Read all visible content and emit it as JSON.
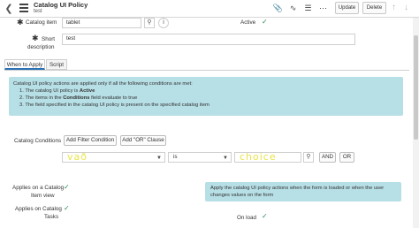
{
  "header": {
    "title": "Catalog UI Policy",
    "subtitle": "test",
    "update_label": "Update",
    "delete_label": "Delete",
    "icons": [
      "attachment-icon",
      "activity-icon",
      "settings-sliders-icon",
      "more-icon",
      "arrow-up-icon",
      "arrow-down-icon"
    ]
  },
  "form": {
    "catalog_item_label": "Catalog item",
    "catalog_item_value": "tablet",
    "active_label": "Active",
    "short_description_label_1": "Short",
    "short_description_label_2": "description",
    "short_description_value": "test"
  },
  "tabs": [
    {
      "label": "When to Apply",
      "active": true
    },
    {
      "label": "Script",
      "active": false
    }
  ],
  "info": {
    "line1": "Catalog UI policy actions are applied only if all the following conditions are met:",
    "item1_prefix": "1. The catalog UI policy is ",
    "item1_bold": "Active",
    "item2_prefix": "2. The items in the ",
    "item2_bold": "Conditions",
    "item2_suffix": " field evaluate to true",
    "item3": "3. The field specified in the catalog UI policy is present on the specified catalog item"
  },
  "conditions": {
    "label": "Catalog Conditions",
    "add_filter_label": "Add Filter Condition",
    "add_or_label": "Add \"OR\" Clause",
    "field_value": "vað",
    "operator_value": "is",
    "value_value": "choice",
    "and_label": "AND",
    "or_label": "OR"
  },
  "apply": {
    "view_label_1": "Applies on a Catalog",
    "view_label_2": "Item view",
    "tasks_label_1": "Applies on Catalog",
    "tasks_label_2": "Tasks",
    "onload_label": "On load",
    "note_1": "Apply the catalog UI policy actions when the form is loaded or when the user",
    "note_2": "changes values on the form"
  }
}
